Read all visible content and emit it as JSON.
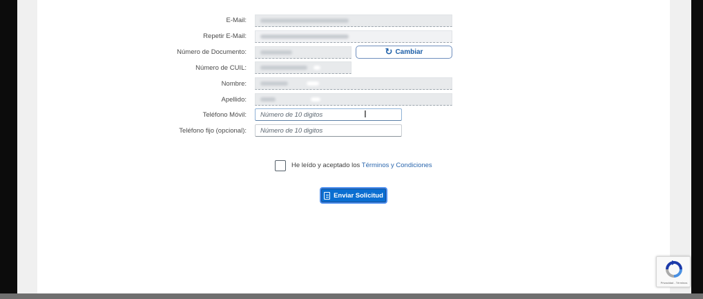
{
  "form": {
    "fields": [
      {
        "label": "E-Mail:",
        "value": "",
        "placeholder": "",
        "state": "readonly"
      },
      {
        "label": "Repetir E-Mail:",
        "value": "",
        "placeholder": "",
        "state": "readonly"
      },
      {
        "label": "Número de Documento:",
        "value": "",
        "placeholder": "",
        "state": "readonly"
      },
      {
        "label": "Número de CUIL:",
        "value": "",
        "placeholder": "",
        "state": "readonly"
      },
      {
        "label": "Nombre:",
        "value": "",
        "placeholder": "",
        "state": "readonly"
      },
      {
        "label": "Apellido:",
        "value": "",
        "placeholder": "",
        "state": "readonly"
      },
      {
        "label": "Teléfono Móvil:",
        "value": "",
        "placeholder": "Número de 10 digitos",
        "state": "focused"
      },
      {
        "label": "Teléfono fijo (opcional):",
        "value": "",
        "placeholder": "Número de 10 digitos",
        "state": "editable"
      }
    ],
    "cambiar_button": {
      "label": "Cambiar",
      "icon": "refresh-icon"
    },
    "terms": {
      "text": "He leído y aceptado los",
      "link": "Términos y Condiciones",
      "checked": false
    },
    "submit_button": {
      "label": "Enviar Solicitud",
      "icon": "document-icon"
    }
  },
  "recaptcha": {
    "icon": "recaptcha-icon",
    "legal": "Privacidad - Términos"
  },
  "colors": {
    "primary_button": "#0a6ed1",
    "link": "#2a66ad",
    "readonly_field": "#e8eaec"
  }
}
